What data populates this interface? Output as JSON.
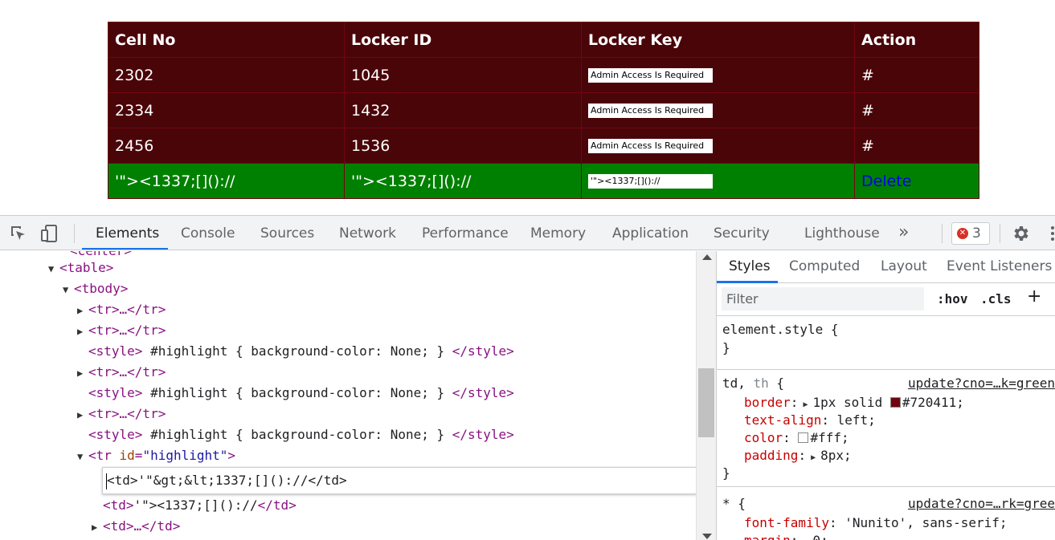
{
  "web_table": {
    "headers": [
      "Cell No",
      "Locker ID",
      "Locker Key",
      "Action"
    ],
    "rows": [
      {
        "cell_no": "2302",
        "locker_id": "1045",
        "locker_key": "Admin Access Is Required",
        "action": "#"
      },
      {
        "cell_no": "2334",
        "locker_id": "1432",
        "locker_key": "Admin Access Is Required",
        "action": "#"
      },
      {
        "cell_no": "2456",
        "locker_id": "1536",
        "locker_key": "Admin Access Is Required",
        "action": "#"
      }
    ],
    "highlight_row": {
      "cell_no": "'\"><1337;[]()://",
      "locker_id": "'\"><1337;[]()://",
      "locker_key": "'\"><1337;[]()://",
      "action": "Delete"
    },
    "colors": {
      "row_bg": "#4a0509",
      "border": "#720411",
      "highlight_bg": "#008000",
      "link": "#0000ee"
    }
  },
  "devtools": {
    "icons": {
      "inspect": "inspect-element-icon",
      "device": "device-toolbar-icon",
      "more_tabs": "chevron-double-right-icon",
      "settings": "gear-icon",
      "menu": "kebab-menu-icon"
    },
    "tabs": [
      "Elements",
      "Console",
      "Sources",
      "Network",
      "Performance",
      "Memory",
      "Application",
      "Security",
      "Lighthouse"
    ],
    "more_tabs": "»",
    "error_count": "3",
    "elements": {
      "line_center": "<center>",
      "line_table": "<table>",
      "line_tbody": "<tbody>",
      "line_tr_collapsed": "<tr>…</tr>",
      "style_open": "<style>",
      "style_text": " #highlight { background-color: None; } ",
      "style_close": "</style>",
      "tr_open": "<tr ",
      "tr_attr_name": "id",
      "tr_attr_eq": "=",
      "tr_attr_value": "\"highlight\"",
      "tr_close": ">",
      "edit_text": "<td>'\"&gt;&lt;1337;[]()://</td>",
      "td_open": "<td>",
      "td_text": "'\"><1337;[]()://",
      "td_close": "</td>",
      "td_collapsed": "<td>…</td>"
    },
    "styles": {
      "tabs": [
        "Styles",
        "Computed",
        "Layout",
        "Event Listeners"
      ],
      "filter_placeholder": "Filter",
      "hov": ":hov",
      "cls": ".cls",
      "plus": "+",
      "element_style": "element.style {",
      "close_brace": "}",
      "rule1": {
        "selector_main": "td",
        "selector_sep": ", ",
        "selector_dim": "th",
        "open": " {",
        "source": "update?cno=…k=green",
        "props": [
          {
            "name": "border",
            "value": "1px solid",
            "color_text": "#720411",
            "color": "#720411"
          },
          {
            "name": "text-align",
            "value": "left;"
          },
          {
            "name": "color",
            "value": "#fff;",
            "color": "#ffffff"
          },
          {
            "name": "padding",
            "value": "8px;"
          }
        ]
      },
      "rule2": {
        "selector": "* {",
        "source": "update?cno=…rk=gree",
        "props": [
          {
            "name": "font-family",
            "value": "'Nunito', sans-serif;"
          },
          {
            "name": "margin",
            "value": "0;"
          }
        ]
      }
    }
  }
}
